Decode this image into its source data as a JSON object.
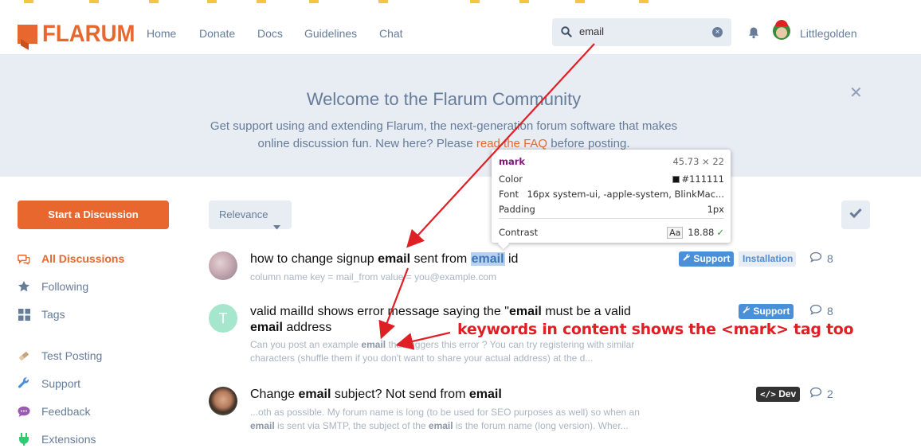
{
  "header": {
    "logo": "FLARUM",
    "nav": [
      "Home",
      "Donate",
      "Docs",
      "Guidelines",
      "Chat"
    ],
    "search_value": "email",
    "username": "Littlegolden"
  },
  "hero": {
    "title": "Welcome to the Flarum Community",
    "desc_before": "Get support using and extending Flarum, the next-generation forum software that makes online discussion fun. New here? Please ",
    "desc_link": "read the FAQ",
    "desc_after": " before posting."
  },
  "sidebar": {
    "start_button": "Start a Discussion",
    "items": [
      {
        "label": "All Discussions",
        "icon": "comments-icon",
        "active": true
      },
      {
        "label": "Following",
        "icon": "star-icon"
      },
      {
        "label": "Tags",
        "icon": "tags-grid-icon"
      },
      {
        "label": "Test Posting",
        "icon": "eraser-icon"
      },
      {
        "label": "Support",
        "icon": "wrench-icon"
      },
      {
        "label": "Feedback",
        "icon": "comment-dots-icon"
      },
      {
        "label": "Extensions",
        "icon": "plug-icon"
      }
    ]
  },
  "toolbar": {
    "sort_label": "Relevance"
  },
  "discussions": [
    {
      "title_parts": [
        "how to change signup ",
        "email",
        " sent from ",
        "email",
        " id"
      ],
      "excerpt": "column name key = mail_from value = you@example.com",
      "tags": [
        "Support",
        "Installation"
      ],
      "replies": "8"
    },
    {
      "title_line1": "valid mailId shows error message saying the \"",
      "title_kw": "email",
      "title_line1_end": " must be a valid",
      "title_line2_kw": "email",
      "title_line2": " address",
      "excerpt_a": "Can you post an example ",
      "excerpt_kw": "email",
      "excerpt_b": " that triggers this error ? You can try registering with similar characters (shuffle them if you don't want to share your actual address) at the d...",
      "avatar_letter": "T",
      "tags": [
        "Support"
      ],
      "replies": "8"
    },
    {
      "title_parts": [
        "Change ",
        "email",
        " subject? Not send from ",
        "email"
      ],
      "excerpt_parts": [
        "...oth as possible. My forum name is long (to be used for SEO purposes as well) so when an ",
        "email",
        " is sent via SMTP, the subject of the ",
        "email",
        " is the forum name (long version). Wher..."
      ],
      "tags": [
        "Dev"
      ],
      "replies": "2"
    }
  ],
  "devtools_tooltip": {
    "tag": "mark",
    "size": "45.73 × 22",
    "color_label": "Color",
    "color_value": "#111111",
    "font_label": "Font",
    "font_value": "16px system-ui, -apple-system, BlinkMac...",
    "padding_label": "Padding",
    "padding_value": "1px",
    "contrast_label": "Contrast",
    "contrast_aa": "Aa",
    "contrast_value": "18.88"
  },
  "annotation": "keywords in content shows the <mark> tag too",
  "colors": {
    "brand": "#e7672e",
    "support_tag": "#4a90d9",
    "installation_tag_text": "#4a90d9",
    "dev_tag": "#333333",
    "annotation_red": "#e01f25"
  }
}
